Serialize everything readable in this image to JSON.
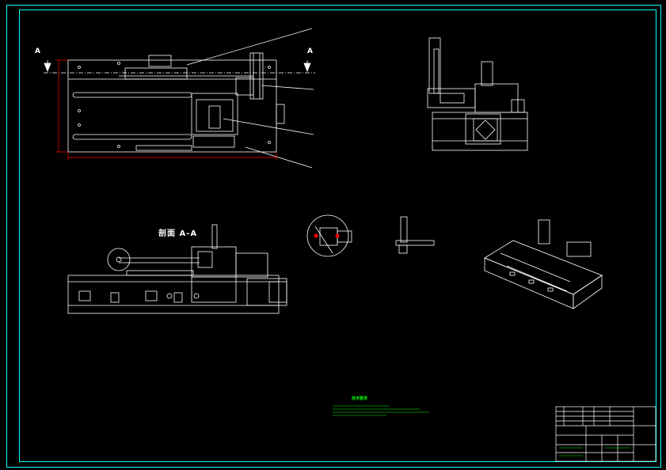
{
  "sheet": {
    "colors": {
      "background": "#000000",
      "frame": "#00ffff",
      "lines": "#ffffff",
      "notes": "#00ff00",
      "dimensions": "#ff0000"
    }
  },
  "plan_view": {
    "section_mark_left": "A",
    "section_mark_right": "A"
  },
  "section_view": {
    "title": "剖面 A-A"
  },
  "detail_views": {
    "tag_left": "",
    "tag_right": ""
  },
  "notes": {
    "title": "技术要求",
    "items": []
  },
  "title_block": {
    "drawing_title": ""
  }
}
